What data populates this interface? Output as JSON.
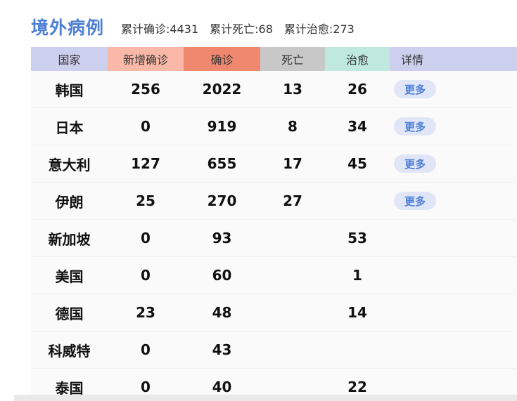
{
  "header": {
    "title": "境外病例",
    "stats": [
      "累计确诊:4431",
      "累计死亡:68",
      "累计治愈:273"
    ]
  },
  "table": {
    "columns": [
      {
        "label": "国家",
        "bg": "#cdcfee"
      },
      {
        "label": "新增确诊",
        "bg": "#f9b8a8"
      },
      {
        "label": "确诊",
        "bg": "#f08870"
      },
      {
        "label": "死亡",
        "bg": "#c8c8c8"
      },
      {
        "label": "治愈",
        "bg": "#bfe9df"
      },
      {
        "label": "详情",
        "bg": "#cdcfee"
      }
    ],
    "more_label": "更多",
    "rows": [
      {
        "country": "韩国",
        "new": "256",
        "confirmed": "2022",
        "deaths": "13",
        "cured": "26",
        "more": true
      },
      {
        "country": "日本",
        "new": "0",
        "confirmed": "919",
        "deaths": "8",
        "cured": "34",
        "more": true
      },
      {
        "country": "意大利",
        "new": "127",
        "confirmed": "655",
        "deaths": "17",
        "cured": "45",
        "more": true
      },
      {
        "country": "伊朗",
        "new": "25",
        "confirmed": "270",
        "deaths": "27",
        "cured": "",
        "more": true
      },
      {
        "country": "新加坡",
        "new": "0",
        "confirmed": "93",
        "deaths": "",
        "cured": "53",
        "more": false
      },
      {
        "country": "美国",
        "new": "0",
        "confirmed": "60",
        "deaths": "",
        "cured": "1",
        "more": false
      },
      {
        "country": "德国",
        "new": "23",
        "confirmed": "48",
        "deaths": "",
        "cured": "14",
        "more": false
      },
      {
        "country": "科威特",
        "new": "0",
        "confirmed": "43",
        "deaths": "",
        "cured": "",
        "more": false
      },
      {
        "country": "泰国",
        "new": "0",
        "confirmed": "40",
        "deaths": "",
        "cured": "22",
        "more": false
      }
    ]
  },
  "colors": {
    "accent": "#4e7fd6",
    "more_button_bg": "#e0e6f7"
  }
}
